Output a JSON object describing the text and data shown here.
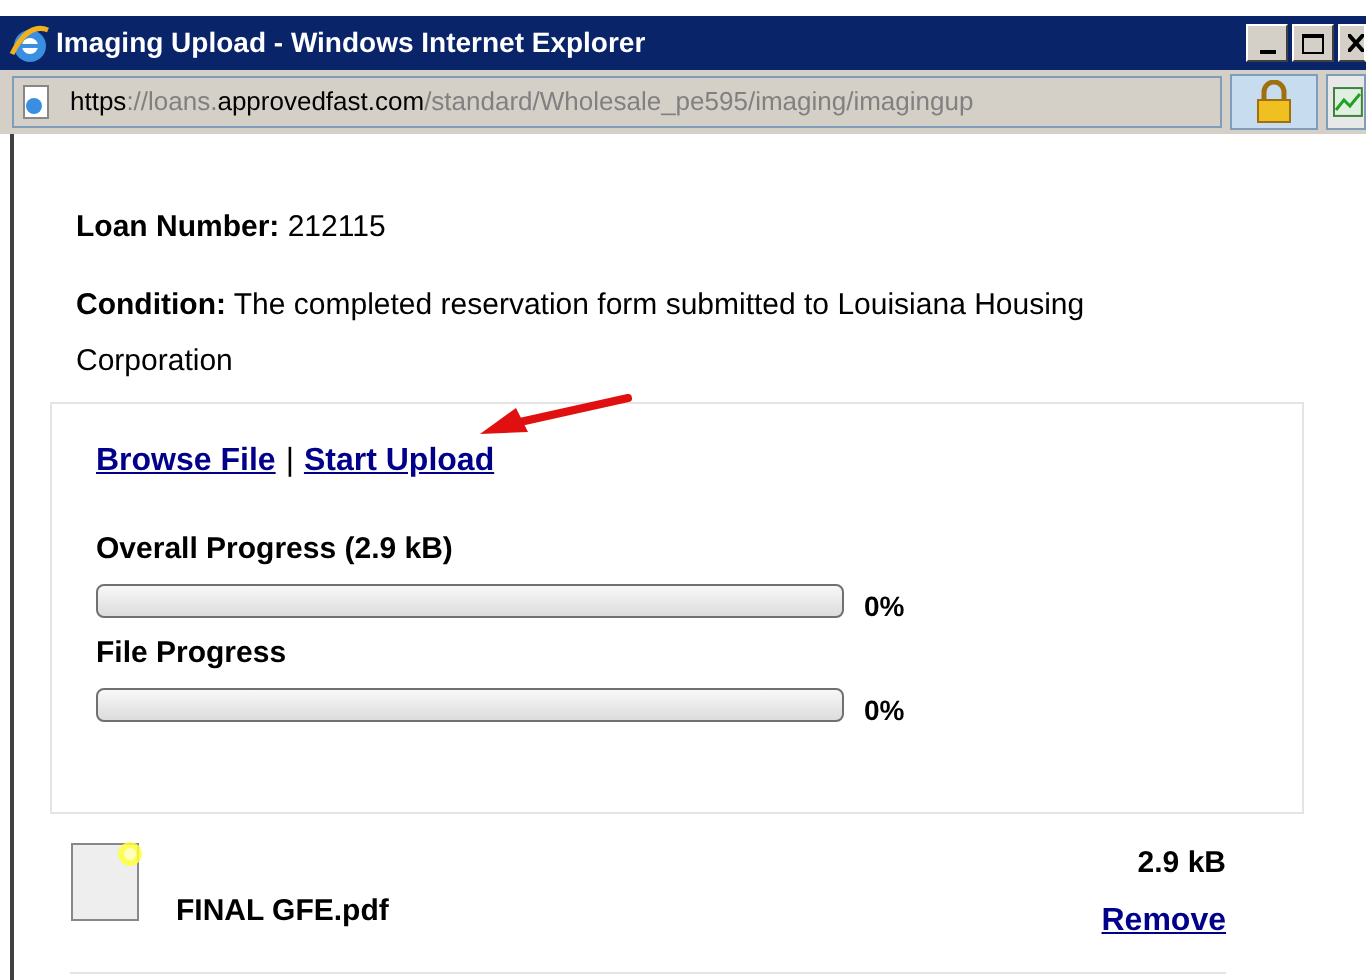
{
  "window": {
    "title": "Imaging Upload - Windows Internet Explorer"
  },
  "address_bar": {
    "segments": [
      {
        "text": "https",
        "highlight": true
      },
      {
        "text": "://loans.",
        "highlight": false
      },
      {
        "text": "approvedfast.com",
        "highlight": true
      },
      {
        "text": "/standard/Wholesale_pe595/imaging/imaginguр",
        "highlight": false
      }
    ]
  },
  "loan": {
    "label": "Loan Number:",
    "value": "212115"
  },
  "condition": {
    "label": "Condition:",
    "value": "The completed reservation form submitted to Louisiana Housing Corporation"
  },
  "actions": {
    "links": [
      "Browse File",
      "Start Upload"
    ],
    "separator": "|"
  },
  "progress": [
    {
      "label": "Overall Progress (2.9 kB)",
      "level": 0,
      "reading": "0%"
    },
    {
      "label": "File Progress",
      "level": 0,
      "reading": "0%"
    }
  ],
  "files": [
    {
      "name": "FINAL GFE.pdf",
      "size": "2.9 kB",
      "action": "Remove"
    }
  ]
}
